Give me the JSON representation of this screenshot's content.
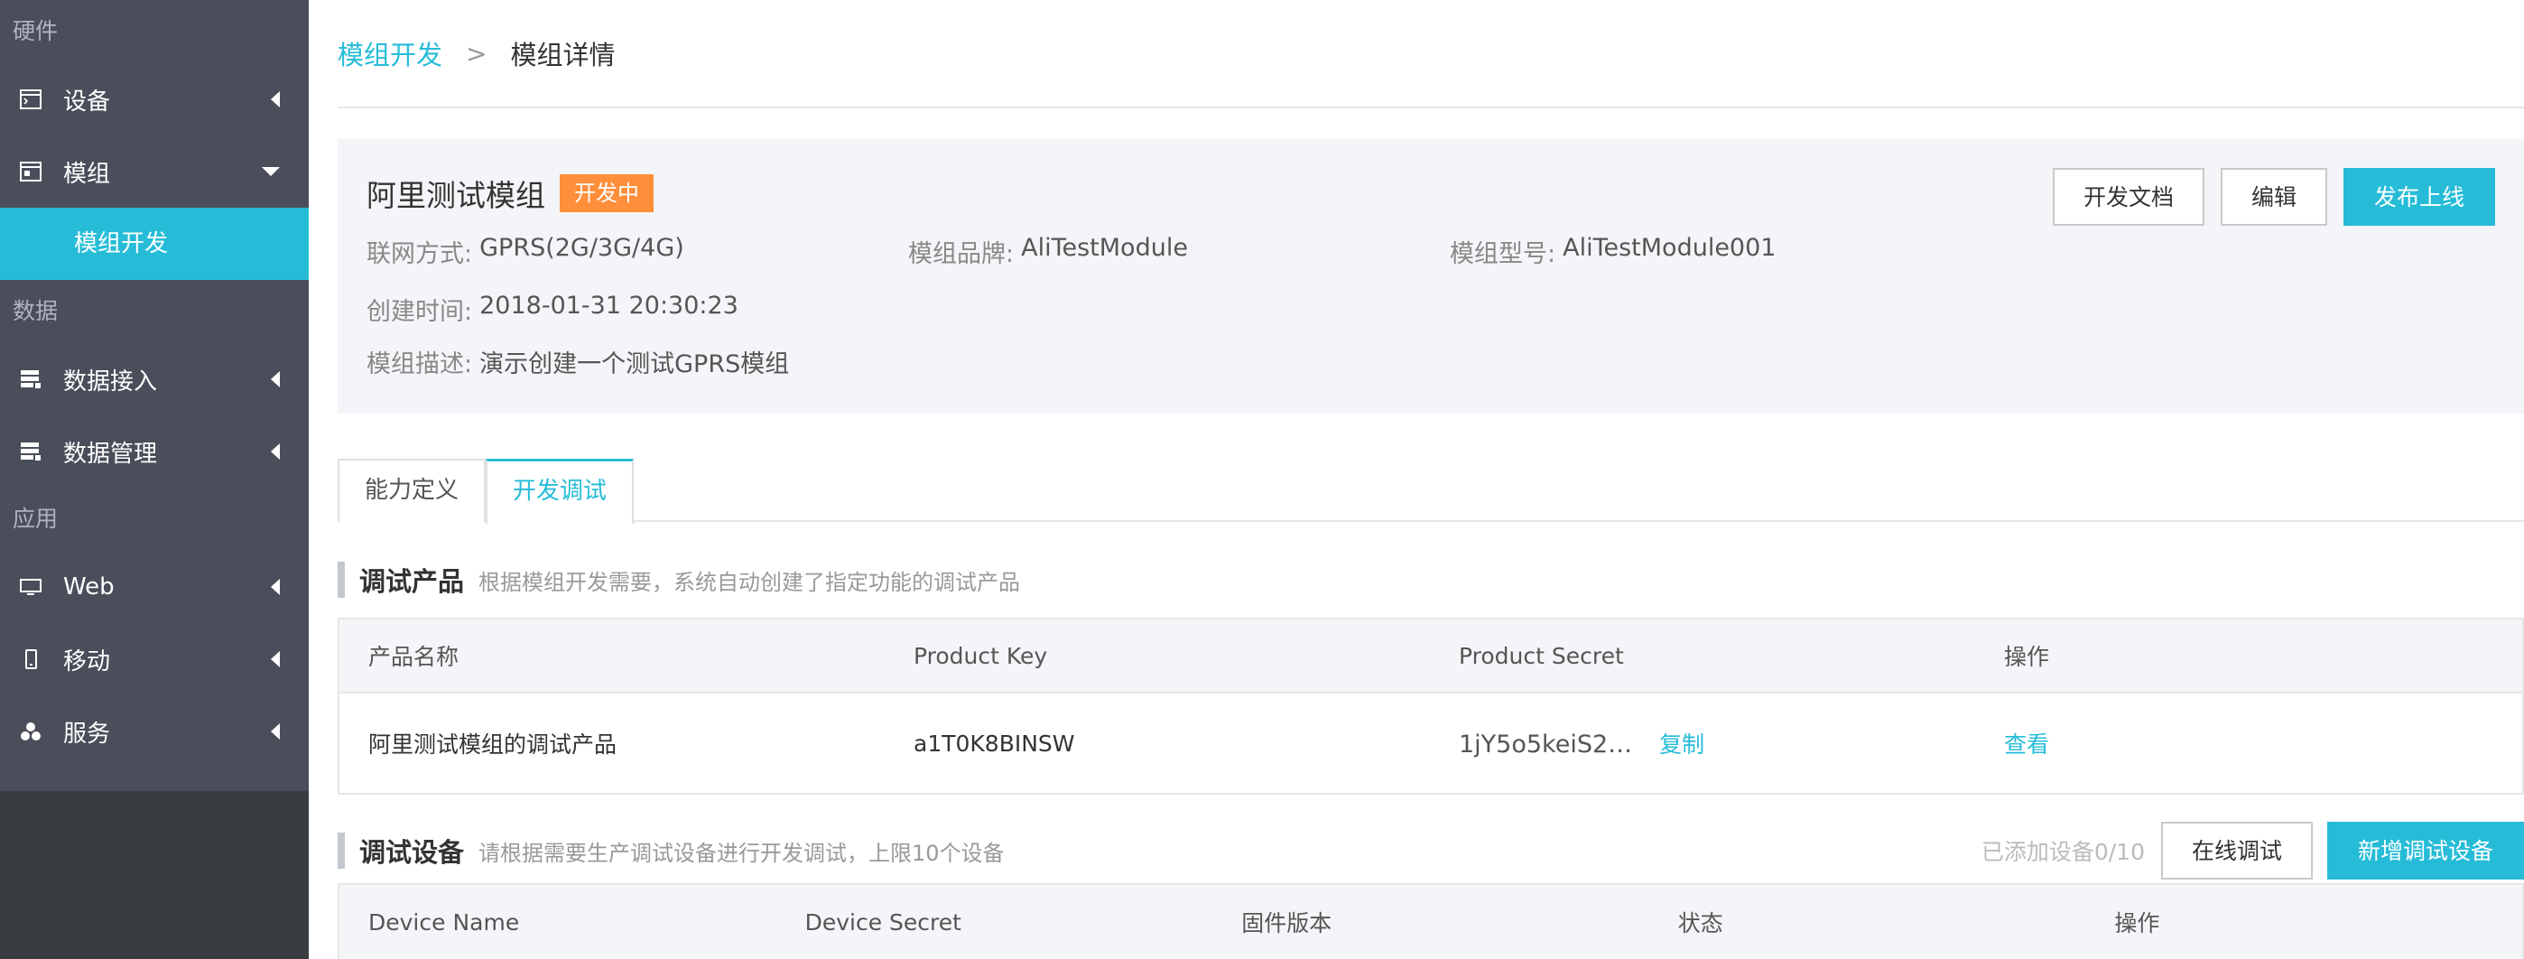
{
  "sidebar": {
    "sections": [
      {
        "title": "硬件",
        "items": [
          {
            "label": "设备",
            "icon": "terminal-icon",
            "state": "collapsed"
          },
          {
            "label": "模组",
            "icon": "window-icon",
            "state": "expanded",
            "sub": [
              "模组开发"
            ]
          }
        ]
      },
      {
        "title": "数据",
        "items": [
          {
            "label": "数据接入",
            "icon": "server-icon",
            "state": "collapsed"
          },
          {
            "label": "数据管理",
            "icon": "server-icon",
            "state": "collapsed"
          }
        ]
      },
      {
        "title": "应用",
        "items": [
          {
            "label": "Web",
            "icon": "monitor-icon",
            "state": "collapsed"
          },
          {
            "label": "移动",
            "icon": "phone-icon",
            "state": "collapsed"
          },
          {
            "label": "服务",
            "icon": "cubes-icon",
            "state": "collapsed"
          }
        ]
      }
    ]
  },
  "breadcrumb": {
    "parent": "模组开发",
    "separator": ">",
    "current": "模组详情"
  },
  "module": {
    "name": "阿里测试模组",
    "status": "开发中",
    "buttons": {
      "docs": "开发文档",
      "edit": "编辑",
      "publish": "发布上线"
    },
    "network": {
      "label": "联网方式:",
      "value": "GPRS(2G/3G/4G)"
    },
    "brand": {
      "label": "模组品牌:",
      "value": "AliTestModule"
    },
    "model": {
      "label": "模组型号:",
      "value": "AliTestModule001"
    },
    "created": {
      "label": "创建时间:",
      "value": "2018-01-31 20:30:23"
    },
    "description": {
      "label": "模组描述:",
      "value": "演示创建一个测试GPRS模组"
    }
  },
  "tabs": [
    "能力定义",
    "开发调试"
  ],
  "debug_product": {
    "title": "调试产品",
    "description": "根据模组开发需要，系统自动创建了指定功能的调试产品",
    "columns": [
      "产品名称",
      "Product Key",
      "Product Secret",
      "操作"
    ],
    "rows": [
      {
        "name": "阿里测试模组的调试产品",
        "key": "a1T0K8BINSW",
        "secret": "1jY5o5keiS2…",
        "copy": "复制",
        "action": "查看"
      }
    ]
  },
  "debug_device": {
    "title": "调试设备",
    "description": "请根据需要生产调试设备进行开发调试，上限10个设备",
    "count": "已添加设备0/10",
    "buttons": {
      "online": "在线调试",
      "add": "新增调试设备"
    },
    "columns": [
      "Device Name",
      "Device Secret",
      "固件版本",
      "状态",
      "操作"
    ]
  },
  "colors": {
    "accent": "#26bcd8",
    "sidebar": "#4a4e5a",
    "badge": "#ff8f3a"
  }
}
